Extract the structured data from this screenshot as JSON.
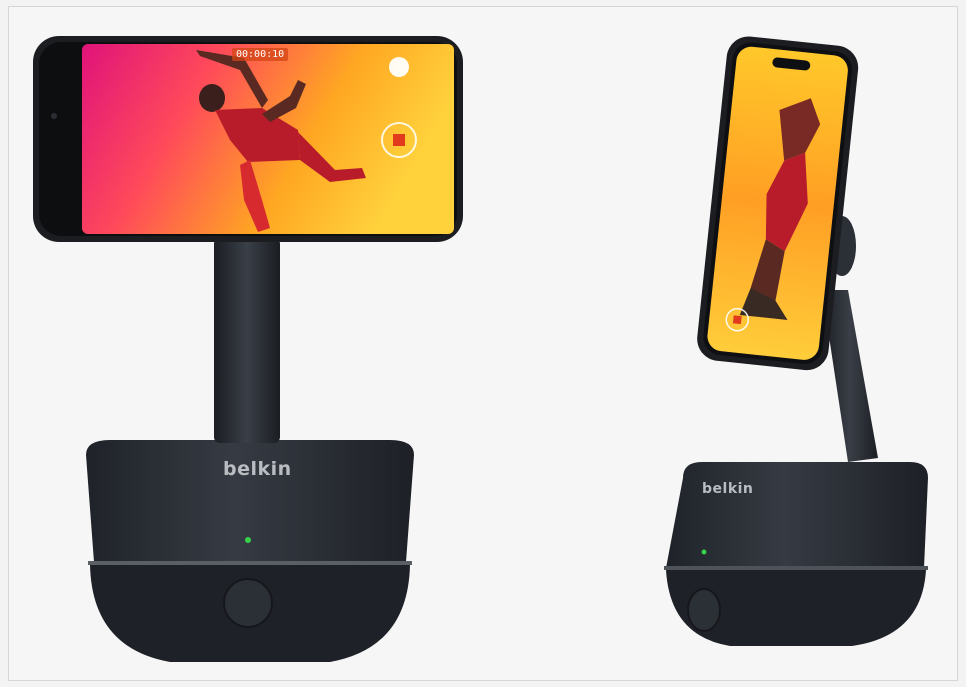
{
  "product_left": {
    "brand_label": "belkin",
    "timer_label": "00:00:10"
  },
  "product_right": {
    "brand_label": "belkin"
  },
  "colors": {
    "background": "#f6f6f6",
    "base": "#2a2e35",
    "screen_warm": "#ffb21c",
    "screen_pink": "#ff2a7a",
    "status_led": "#38d24a"
  }
}
